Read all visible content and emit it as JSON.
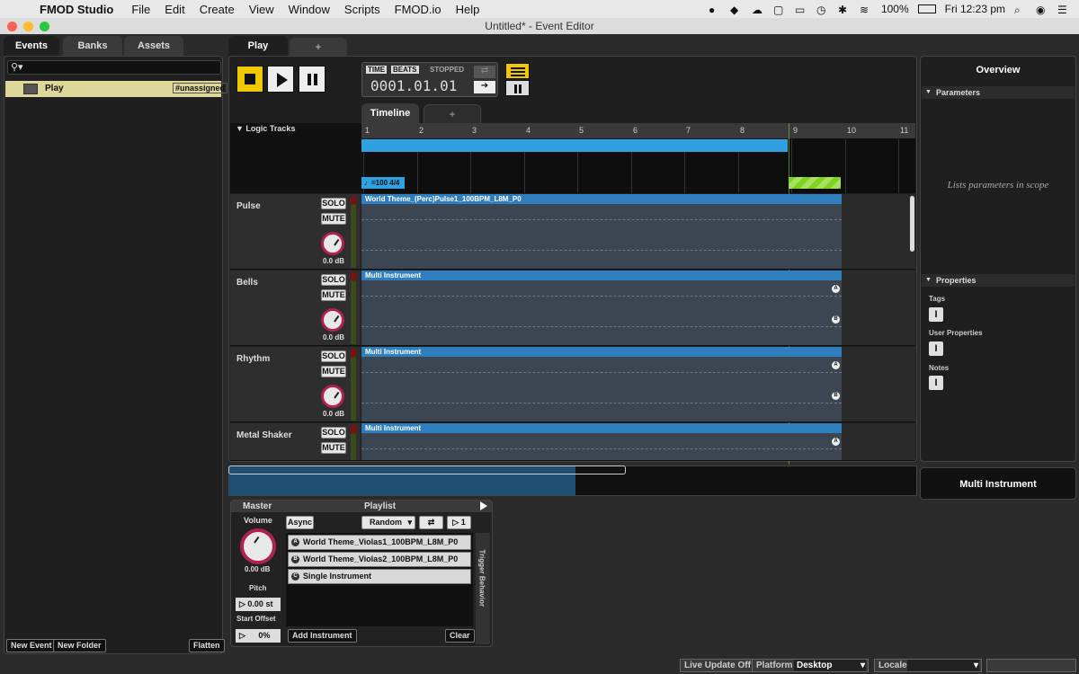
{
  "menubar": {
    "app": "FMOD Studio",
    "items": [
      "File",
      "Edit",
      "Create",
      "View",
      "Window",
      "Scripts",
      "FMOD.io",
      "Help"
    ],
    "battery": "100%",
    "clock": "Fri 12:23 pm"
  },
  "window": {
    "title": "Untitled* - Event Editor"
  },
  "browser": {
    "tabs": [
      "Events",
      "Banks",
      "Assets"
    ],
    "event_name": "Play",
    "event_tag": "#unassigned",
    "footer": {
      "new_event": "New Event",
      "new_folder": "New Folder",
      "flatten": "Flatten"
    }
  },
  "editor": {
    "tab": "Play",
    "add_tab": "+",
    "transport": {
      "time_label": "TIME",
      "beats_label": "BEATS",
      "state": "STOPPED",
      "position": "0001.01.01"
    },
    "timeline_tab": "Timeline",
    "logic_tracks": "Logic Tracks",
    "ruler": [
      "1",
      "2",
      "3",
      "4",
      "5",
      "6",
      "7",
      "8",
      "9",
      "10",
      "11"
    ],
    "tempo_marker": "♩=100 4/4",
    "tracks": [
      {
        "name": "Pulse",
        "solo": "SOLO",
        "mute": "MUTE",
        "db": "0.0 dB",
        "clip": "World Theme_(Perc)Pulse1_100BPM_L8M_P0"
      },
      {
        "name": "Bells",
        "solo": "SOLO",
        "mute": "MUTE",
        "db": "0.0 dB",
        "clip": "Multi Instrument"
      },
      {
        "name": "Rhythm",
        "solo": "SOLO",
        "mute": "MUTE",
        "db": "0.0 dB",
        "clip": "Multi Instrument"
      },
      {
        "name": "Metal Shaker",
        "solo": "SOLO",
        "mute": "MUTE",
        "db": "",
        "clip": "Multi Instrument"
      }
    ]
  },
  "deck": {
    "master": "Master",
    "volume_label": "Volume",
    "volume_value": "0.00 dB",
    "pitch_label": "Pitch",
    "pitch_value": "0.00 st",
    "start_offset_label": "Start Offset",
    "start_offset_value": "0%",
    "playlist_label": "Playlist",
    "async": "Async",
    "mode": "Random",
    "count": "1",
    "items": [
      {
        "badge": "A",
        "name": "World Theme_Violas1_100BPM_L8M_P0"
      },
      {
        "badge": "B",
        "name": "World Theme_Violas2_100BPM_L8M_P0"
      },
      {
        "badge": "C",
        "name": "Single Instrument"
      }
    ],
    "trigger_behavior": "Trigger Behavior",
    "add_instrument": "Add Instrument",
    "clear": "Clear"
  },
  "overview": {
    "title": "Overview",
    "parameters": "Parameters",
    "params_hint": "Lists parameters in scope",
    "properties": "Properties",
    "tags": "Tags",
    "user_properties": "User Properties",
    "notes": "Notes",
    "selection_title": "Multi Instrument"
  },
  "statusbar": {
    "live_update": "Live Update Off",
    "platform_label": "Platform",
    "platform_value": "Desktop",
    "locale_label": "Locale"
  },
  "colors": {
    "accent": "#f0c800",
    "clip": "#2f7fbf",
    "lane": "#3b4652",
    "knob_ring": "#b02050",
    "loop_green": "#7ed321"
  }
}
